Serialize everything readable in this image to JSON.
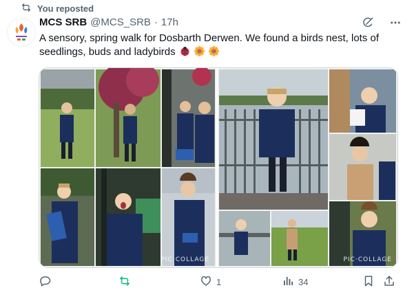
{
  "repost": {
    "label": "You reposted"
  },
  "author": {
    "name": "MCS SRB",
    "handle": "@MCS_SRB",
    "separator": "·",
    "time": "17h"
  },
  "tweet": {
    "text": "A  sensory, spring walk for Dosbarth Derwen. We found a birds nest, lots of seedlings, buds and ladybirds",
    "emojis": [
      "ladybug-emoji",
      "sunflower-emoji",
      "sunflower-emoji"
    ]
  },
  "media": {
    "watermark": "PIC·COLLAGE"
  },
  "actions": {
    "replies": "",
    "reposts": "",
    "likes": "1",
    "views": "34"
  },
  "colors": {
    "text": "#0f1419",
    "muted": "#536471",
    "repost_active": "#00ba7c",
    "border": "#cfd9de"
  }
}
